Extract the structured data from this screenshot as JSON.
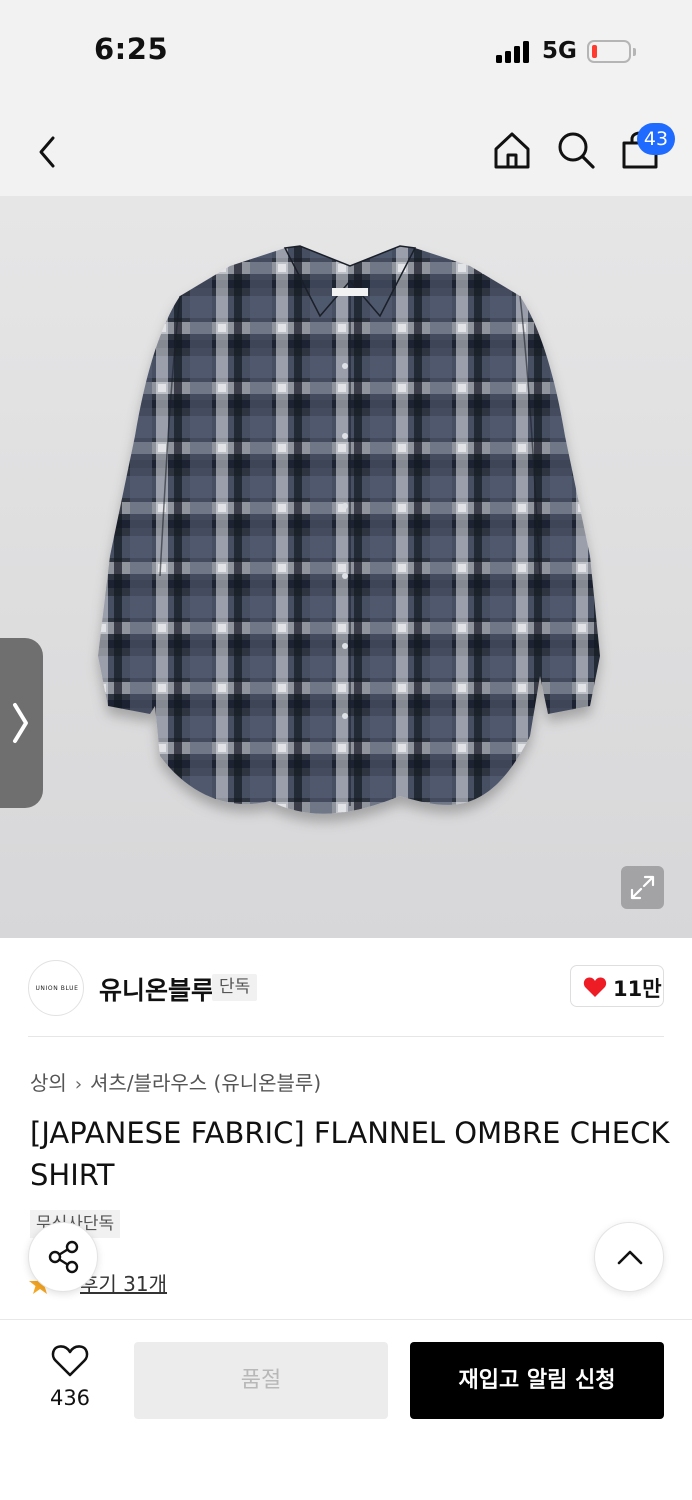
{
  "status_bar": {
    "time": "6:25",
    "network": "5G",
    "battery_level": 0.15
  },
  "header": {
    "cart_badge": "43"
  },
  "gallery": {
    "image_alt": "Flannel ombre check shirt"
  },
  "brand": {
    "logo_text": "UNION BLUE",
    "name": "유니온블루",
    "exclusive_tag": "단독",
    "likes": "11만"
  },
  "breadcrumb": {
    "level1": "상의",
    "level2": "셔츠/블라우스 (유니온블루)"
  },
  "product": {
    "title": "[JAPANESE FABRIC] FLANNEL OMBRE CHECK SHIRT",
    "tag": "무신사단독",
    "review_label": "후기 31개"
  },
  "bottom_bar": {
    "wish_count": "436",
    "soldout_label": "품절",
    "restock_label": "재입고 알림 신청"
  },
  "colors": {
    "accent_blue": "#1f6bff",
    "heart_red": "#ee1c25",
    "star_orange": "#f5a623"
  }
}
